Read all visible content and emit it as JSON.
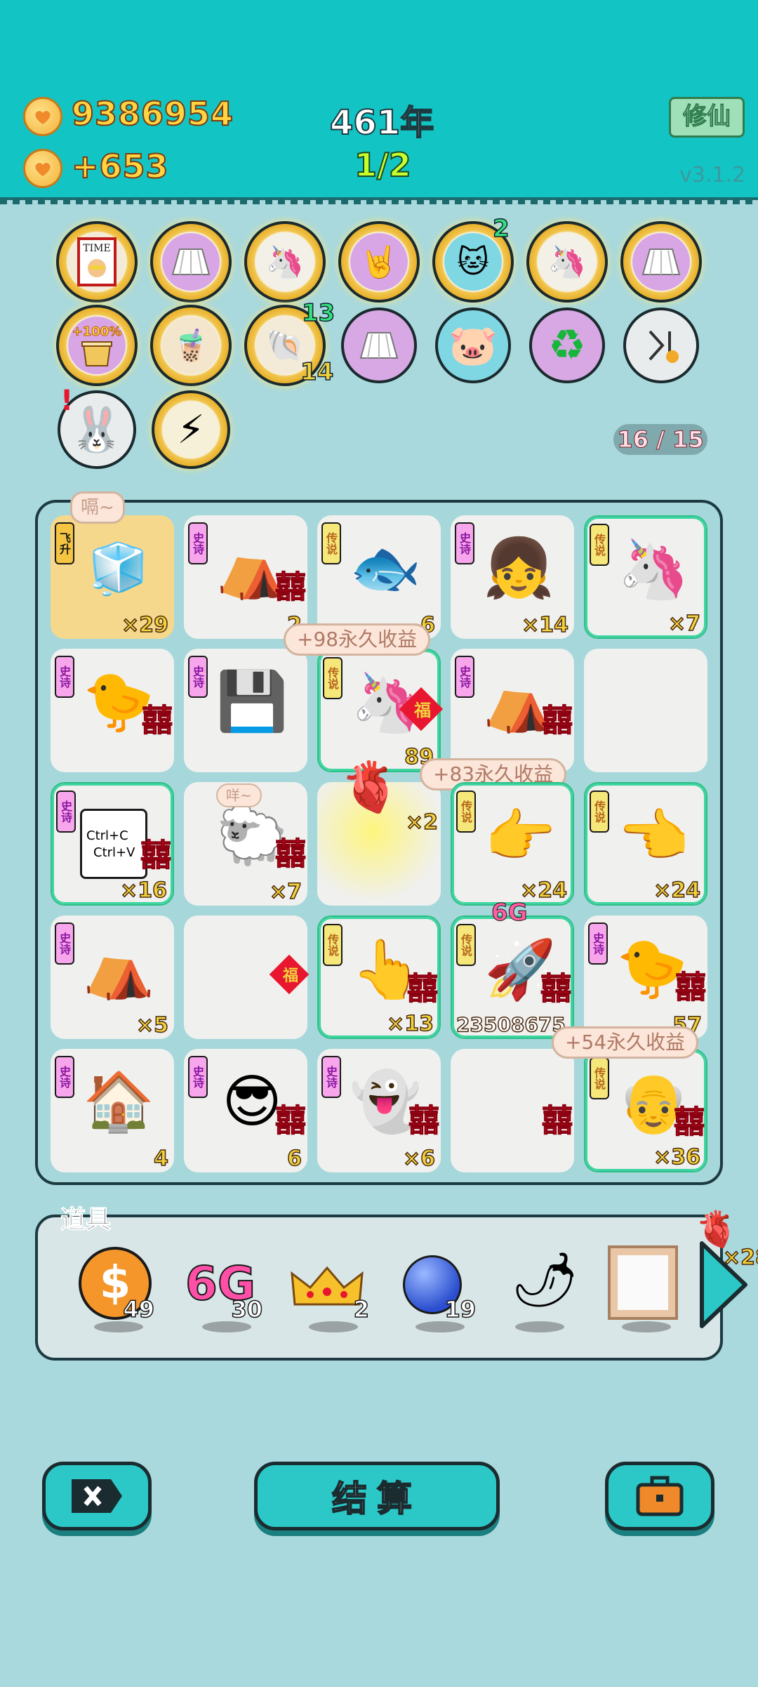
{
  "header": {
    "coins": "9386954",
    "coin_rate": "+653",
    "year": "461年",
    "stage": "1/2",
    "xiuxian_label": "修仙",
    "version": "v3.1.2"
  },
  "buffs": {
    "row1_counts": [
      "2"
    ],
    "row2_counts": [
      "13",
      "14"
    ],
    "capacity": "16 / 15"
  },
  "board": {
    "bubble_top": "嗝~",
    "bubble_sheep": "咩~",
    "income_1": "+98永久收益",
    "income_2": "+83永久收益",
    "income_3": "+54永久收益",
    "tags": {
      "epic": "史诗",
      "legend": "传说",
      "ascend": "飞升"
    },
    "xi": "囍",
    "cells": {
      "r1c1": "×29",
      "r1c2": "2",
      "r1c3": "6",
      "r1c4": "×14",
      "r1c5": "×7",
      "r2c3": "89",
      "r3c1": "×16",
      "r3c2": "×7",
      "r3c3": "×2",
      "r3c4": "×24",
      "r3c5": "×24",
      "r4c1": "×5",
      "r4c3": "×13",
      "r4c4": "23508675",
      "r4c5": "57",
      "r5c1": "4",
      "r5c2": "6",
      "r5c3": "×6",
      "r5c5": "×36"
    },
    "ctrl_c": "Ctrl+C",
    "ctrl_v": "Ctrl+V",
    "six_g": "6G",
    "fu": "福"
  },
  "items": {
    "title": "道具",
    "list": [
      {
        "name": "dollar-coin",
        "count": "49"
      },
      {
        "name": "6g",
        "label": "6G",
        "count": "30"
      },
      {
        "name": "crown",
        "count": "2"
      },
      {
        "name": "blueberry",
        "count": "19"
      },
      {
        "name": "chili",
        "count": ""
      },
      {
        "name": "frame",
        "count": ""
      }
    ],
    "liver_count": "×28"
  },
  "buttons": {
    "settle": "结算"
  }
}
